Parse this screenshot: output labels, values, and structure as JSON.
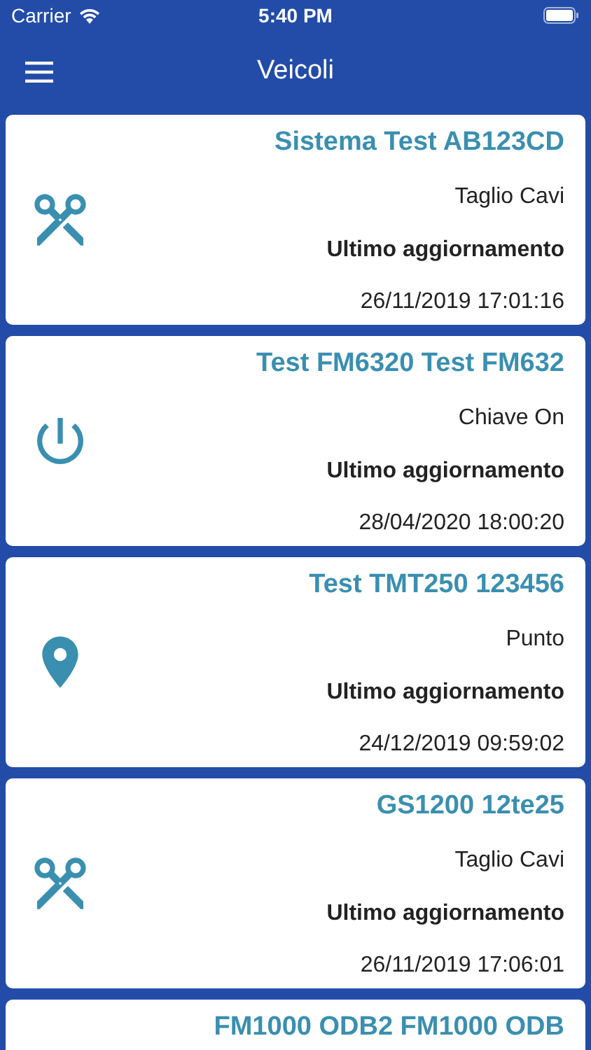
{
  "status_bar": {
    "carrier": "Carrier",
    "time": "5:40 PM"
  },
  "nav": {
    "title": "Veicoli"
  },
  "vehicles": [
    {
      "name": "Sistema Test AB123CD",
      "kind": "cut",
      "status": "Taglio Cavi",
      "label": "Ultimo aggiornamento",
      "updated": "26/11/2019 17:01:16"
    },
    {
      "name": "Test FM6320 Test FM632",
      "kind": "power",
      "status": "Chiave On",
      "label": "Ultimo aggiornamento",
      "updated": "28/04/2020 18:00:20"
    },
    {
      "name": "Test TMT250 123456",
      "kind": "pin",
      "status": "Punto",
      "label": "Ultimo aggiornamento",
      "updated": "24/12/2019 09:59:02"
    },
    {
      "name": "GS1200 12te25",
      "kind": "cut",
      "status": "Taglio Cavi",
      "label": "Ultimo aggiornamento",
      "updated": "26/11/2019 17:06:01"
    },
    {
      "name": "FM1000 ODB2 FM1000 ODB"
    }
  ]
}
